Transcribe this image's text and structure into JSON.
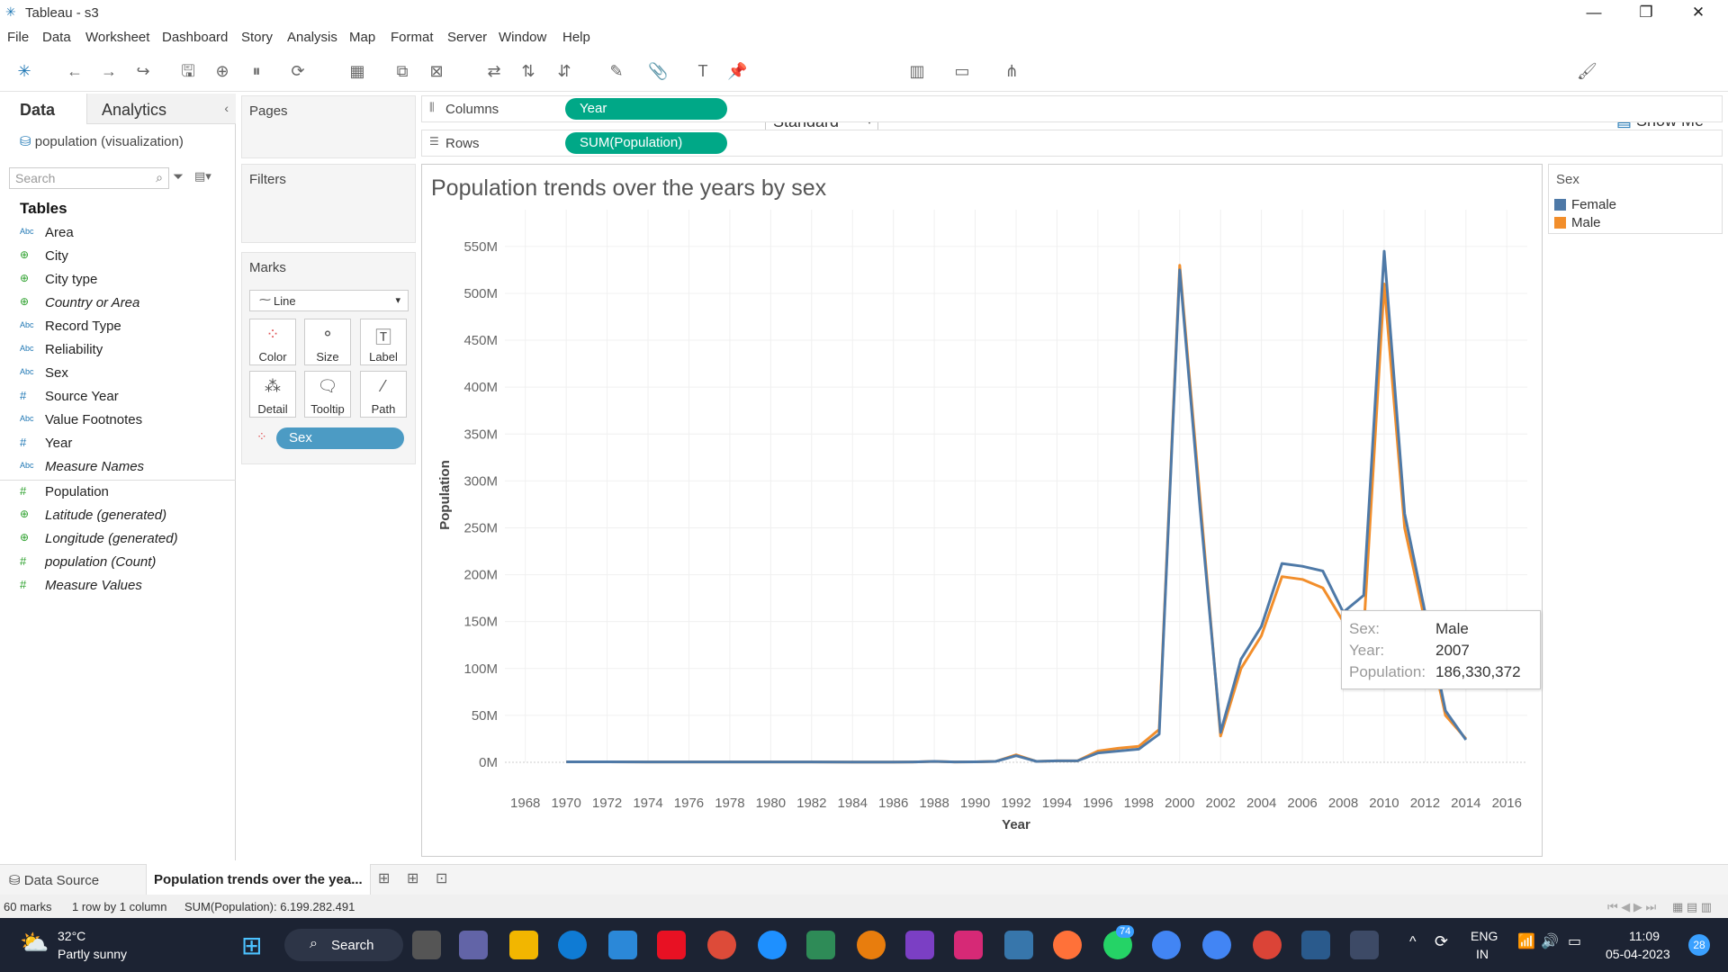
{
  "window": {
    "title": "Tableau - s3"
  },
  "menu": [
    "File",
    "Data",
    "Worksheet",
    "Dashboard",
    "Story",
    "Analysis",
    "Map",
    "Format",
    "Server",
    "Window",
    "Help"
  ],
  "toolbar": {
    "fit": "Standard",
    "show_me": "Show Me"
  },
  "data_pane": {
    "tab_data": "Data",
    "tab_analytics": "Analytics",
    "datasource": "population (visualization)",
    "search_placeholder": "Search",
    "tables_heading": "Tables",
    "fields": [
      {
        "name": "Area",
        "type": "Abc"
      },
      {
        "name": "City",
        "type": "geo"
      },
      {
        "name": "City type",
        "type": "geo"
      },
      {
        "name": "Country or Area",
        "type": "geo"
      },
      {
        "name": "Record Type",
        "type": "Abc"
      },
      {
        "name": "Reliability",
        "type": "Abc"
      },
      {
        "name": "Sex",
        "type": "Abc"
      },
      {
        "name": "Source Year",
        "type": "#"
      },
      {
        "name": "Value Footnotes",
        "type": "Abc"
      },
      {
        "name": "Year",
        "type": "#"
      },
      {
        "name": "Measure Names",
        "type": "Abc"
      }
    ],
    "measures": [
      {
        "name": "Population",
        "type": "#"
      },
      {
        "name": "Latitude (generated)",
        "type": "geo"
      },
      {
        "name": "Longitude (generated)",
        "type": "geo"
      },
      {
        "name": "population (Count)",
        "type": "#"
      },
      {
        "name": "Measure Values",
        "type": "#"
      }
    ]
  },
  "cards": {
    "pages": "Pages",
    "filters": "Filters",
    "marks": "Marks",
    "mark_type": "Line",
    "buttons": [
      "Color",
      "Size",
      "Label",
      "Detail",
      "Tooltip",
      "Path"
    ],
    "pill": "Sex"
  },
  "shelves": {
    "columns_label": "Columns",
    "columns_pill": "Year",
    "rows_label": "Rows",
    "rows_pill": "SUM(Population)"
  },
  "legend": {
    "title": "Sex",
    "items": [
      {
        "name": "Female",
        "color": "#4e79a7"
      },
      {
        "name": "Male",
        "color": "#f28e2b"
      }
    ]
  },
  "tooltip": {
    "k1": "Sex:",
    "v1": "Male",
    "k2": "Year:",
    "v2": "2007",
    "k3": "Population:",
    "v3": "186,330,372"
  },
  "sheets": {
    "data_source": "Data Source",
    "sheet": "Population trends over the yea..."
  },
  "status": {
    "marks": "60 marks",
    "grid": "1 row by 1 column",
    "sum": "SUM(Population): 6.199.282.491"
  },
  "taskbar": {
    "temp": "32°C",
    "weather": "Partly sunny",
    "search": "Search",
    "lang1": "ENG",
    "lang2": "IN",
    "time": "11:09",
    "date": "05-04-2023",
    "badge": "28",
    "wa_badge": "74"
  },
  "chart_data": {
    "type": "line",
    "title": "Population trends over the years by sex",
    "xlabel": "Year",
    "ylabel": "Population",
    "xlim": [
      1967,
      2017
    ],
    "ylim": [
      0,
      570
    ],
    "x_ticks": [
      1968,
      1970,
      1972,
      1974,
      1976,
      1978,
      1980,
      1982,
      1984,
      1986,
      1988,
      1990,
      1992,
      1994,
      1996,
      1998,
      2000,
      2002,
      2004,
      2006,
      2008,
      2010,
      2012,
      2014,
      2016
    ],
    "y_ticks": [
      {
        "v": 0,
        "label": "0M"
      },
      {
        "v": 50,
        "label": "50M"
      },
      {
        "v": 100,
        "label": "100M"
      },
      {
        "v": 150,
        "label": "150M"
      },
      {
        "v": 200,
        "label": "200M"
      },
      {
        "v": 250,
        "label": "250M"
      },
      {
        "v": 300,
        "label": "300M"
      },
      {
        "v": 350,
        "label": "350M"
      },
      {
        "v": 400,
        "label": "400M"
      },
      {
        "v": 450,
        "label": "450M"
      },
      {
        "v": 500,
        "label": "500M"
      },
      {
        "v": 550,
        "label": "550M"
      }
    ],
    "series": [
      {
        "name": "Male",
        "color": "#f28e2b",
        "x": [
          1970,
          1972,
          1974,
          1976,
          1978,
          1980,
          1982,
          1984,
          1986,
          1987,
          1988,
          1989,
          1990,
          1991,
          1992,
          1993,
          1994,
          1995,
          1996,
          1997,
          1998,
          1999,
          2000,
          2001,
          2002,
          2003,
          2004,
          2005,
          2006,
          2007,
          2008,
          2009,
          2010,
          2011,
          2012,
          2013,
          2014
        ],
        "y": [
          0.5,
          0.5,
          0.4,
          0.4,
          0.4,
          0.4,
          0.4,
          0.3,
          0.3,
          0.4,
          1,
          0.4,
          0.5,
          1,
          8,
          1,
          1.5,
          1.5,
          12,
          15,
          17,
          35,
          530,
          280,
          28,
          100,
          135,
          198,
          195,
          186,
          150,
          140,
          510,
          250,
          150,
          50,
          25
        ]
      },
      {
        "name": "Female",
        "color": "#4e79a7",
        "x": [
          1970,
          1972,
          1974,
          1976,
          1978,
          1980,
          1982,
          1984,
          1986,
          1987,
          1988,
          1989,
          1990,
          1991,
          1992,
          1993,
          1994,
          1995,
          1996,
          1997,
          1998,
          1999,
          2000,
          2001,
          2002,
          2003,
          2004,
          2005,
          2006,
          2007,
          2008,
          2009,
          2010,
          2011,
          2012,
          2013,
          2014
        ],
        "y": [
          0.5,
          0.5,
          0.4,
          0.4,
          0.4,
          0.4,
          0.4,
          0.3,
          0.3,
          0.4,
          1,
          0.4,
          0.5,
          1,
          7,
          1,
          1.5,
          1.5,
          10,
          12,
          14,
          30,
          525,
          270,
          32,
          110,
          145,
          212,
          209,
          204,
          160,
          178,
          545,
          265,
          160,
          55,
          24
        ]
      }
    ]
  }
}
